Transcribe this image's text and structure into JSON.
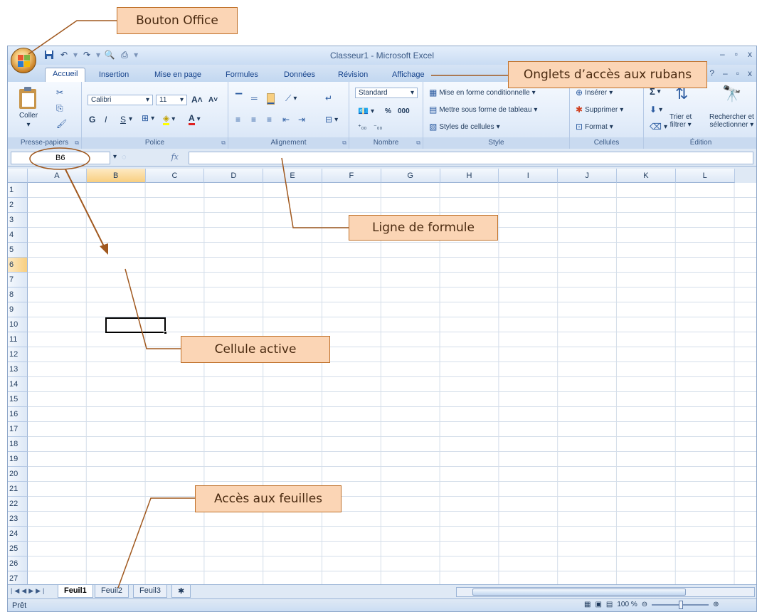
{
  "callouts": {
    "office_button": "Bouton Office",
    "ribbon_tabs": "Onglets d’accès aux rubans",
    "formula_bar": "Ligne de formule",
    "active_cell": "Cellule active",
    "sheet_access": "Accès aux feuilles"
  },
  "window": {
    "title": "Classeur1 - Microsoft Excel"
  },
  "tabs": [
    "Accueil",
    "Insertion",
    "Mise en page",
    "Formules",
    "Données",
    "Révision",
    "Affichage"
  ],
  "ribbon": {
    "clipboard": {
      "label": "Presse-papiers",
      "paste": "Coller"
    },
    "font": {
      "label": "Police",
      "name": "Calibri",
      "size": "11",
      "bold": "G",
      "italic": "I",
      "underline": "S"
    },
    "alignment": {
      "label": "Alignement"
    },
    "number": {
      "label": "Nombre",
      "format": "Standard",
      "percent": "%",
      "thousands": "000"
    },
    "style": {
      "label": "Style",
      "conditional": "Mise en forme conditionnelle",
      "as_table": "Mettre sous forme de tableau",
      "cell_styles": "Styles de cellules"
    },
    "cells": {
      "label": "Cellules",
      "insert": "Insérer",
      "delete": "Supprimer",
      "format": "Format"
    },
    "editing": {
      "label": "Édition",
      "sort_l1": "Trier et",
      "sort_l2": "filtrer",
      "find_l1": "Rechercher et",
      "find_l2": "sélectionner"
    }
  },
  "formula_bar": {
    "name_box": "B6",
    "fx": "fx",
    "value": ""
  },
  "columns": [
    "A",
    "B",
    "C",
    "D",
    "E",
    "F",
    "G",
    "H",
    "I",
    "J",
    "K",
    "L"
  ],
  "selected_column": "B",
  "rows": [
    "1",
    "2",
    "3",
    "4",
    "5",
    "6",
    "7",
    "8",
    "9",
    "10",
    "11",
    "12",
    "13",
    "14",
    "15",
    "16",
    "17",
    "18",
    "19",
    "20",
    "21",
    "22",
    "23",
    "24",
    "25",
    "26",
    "27"
  ],
  "selected_row": "6",
  "sheets": [
    "Feuil1",
    "Feuil2",
    "Feuil3"
  ],
  "active_sheet": "Feuil1",
  "status": {
    "text": "Prêt",
    "zoom": "100 %"
  },
  "colors": {
    "accent": "#f8cf80",
    "callout_bg": "#fbd5b5",
    "callout_line": "#a0581e"
  }
}
